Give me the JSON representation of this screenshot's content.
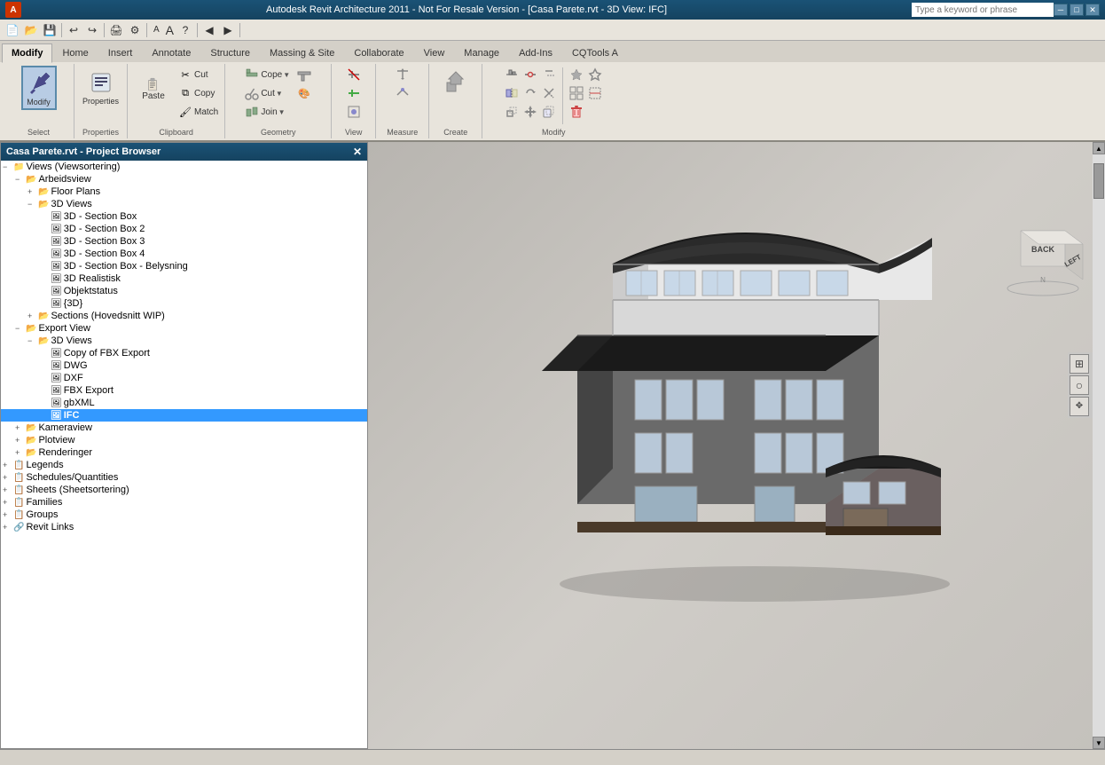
{
  "title_bar": {
    "title": "Autodesk Revit Architecture 2011 - Not For Resale Version - [Casa Parete.rvt - 3D View: IFC]",
    "search_placeholder": "Type a keyword or phrase"
  },
  "ribbon": {
    "tabs": [
      {
        "label": "Modify",
        "active": true
      },
      {
        "label": "Home",
        "active": false
      },
      {
        "label": "Insert",
        "active": false
      },
      {
        "label": "Annotate",
        "active": false
      },
      {
        "label": "Structure",
        "active": false
      },
      {
        "label": "Massing & Site",
        "active": false
      },
      {
        "label": "Collaborate",
        "active": false
      },
      {
        "label": "View",
        "active": false
      },
      {
        "label": "Manage",
        "active": false
      },
      {
        "label": "Add-Ins",
        "active": false
      },
      {
        "label": "CQTools A",
        "active": false
      }
    ],
    "groups": {
      "select": {
        "label": "Select",
        "btn_label": "Modify"
      },
      "properties": {
        "label": "Properties"
      },
      "clipboard": {
        "label": "Clipboard",
        "paste": "Paste"
      },
      "geometry": {
        "label": "Geometry",
        "cope": "Cope",
        "cut": "Cut",
        "join": "Join"
      },
      "view": {
        "label": "View"
      },
      "measure": {
        "label": "Measure"
      },
      "create": {
        "label": "Create"
      },
      "modify": {
        "label": "Modify"
      }
    }
  },
  "project_browser": {
    "title": "Casa Parete.rvt - Project Browser",
    "tree": [
      {
        "id": "views",
        "label": "Views (Viewsortering)",
        "level": 0,
        "type": "root",
        "expanded": true
      },
      {
        "id": "arbeidsview",
        "label": "Arbeidsview",
        "level": 1,
        "type": "folder",
        "expanded": true
      },
      {
        "id": "floor-plans",
        "label": "Floor Plans",
        "level": 2,
        "type": "folder",
        "expanded": false
      },
      {
        "id": "3d-views",
        "label": "3D Views",
        "level": 2,
        "type": "folder",
        "expanded": true
      },
      {
        "id": "section-box",
        "label": "3D - Section Box",
        "level": 3,
        "type": "view"
      },
      {
        "id": "section-box-2",
        "label": "3D - Section Box 2",
        "level": 3,
        "type": "view"
      },
      {
        "id": "section-box-3",
        "label": "3D - Section Box 3",
        "level": 3,
        "type": "view"
      },
      {
        "id": "section-box-4",
        "label": "3D - Section Box 4",
        "level": 3,
        "type": "view"
      },
      {
        "id": "section-box-bel",
        "label": "3D - Section Box - Belysning",
        "level": 3,
        "type": "view"
      },
      {
        "id": "3d-realistisk",
        "label": "3D Realistisk",
        "level": 3,
        "type": "view"
      },
      {
        "id": "objektstatus",
        "label": "Objektstatus",
        "level": 3,
        "type": "view"
      },
      {
        "id": "3d-curly",
        "label": "{3D}",
        "level": 3,
        "type": "view"
      },
      {
        "id": "sections-hoved",
        "label": "Sections (Hovedsnitt WIP)",
        "level": 2,
        "type": "folder",
        "expanded": false
      },
      {
        "id": "export-view",
        "label": "Export View",
        "level": 1,
        "type": "folder",
        "expanded": true
      },
      {
        "id": "3d-views-export",
        "label": "3D Views",
        "level": 2,
        "type": "folder",
        "expanded": true
      },
      {
        "id": "copy-fbx",
        "label": "Copy of FBX Export",
        "level": 3,
        "type": "view"
      },
      {
        "id": "dwf",
        "label": "DWG",
        "level": 3,
        "type": "view"
      },
      {
        "id": "dxf",
        "label": "DXF",
        "level": 3,
        "type": "view"
      },
      {
        "id": "fbx-export",
        "label": "FBX Export",
        "level": 3,
        "type": "view"
      },
      {
        "id": "gbxml",
        "label": "gbXML",
        "level": 3,
        "type": "view"
      },
      {
        "id": "ifc",
        "label": "IFC",
        "level": 3,
        "type": "view",
        "selected": true
      },
      {
        "id": "kameraview",
        "label": "Kameraview",
        "level": 1,
        "type": "folder",
        "expanded": false
      },
      {
        "id": "plotview",
        "label": "Plotview",
        "level": 1,
        "type": "folder",
        "expanded": false
      },
      {
        "id": "renderinger",
        "label": "Renderinger",
        "level": 1,
        "type": "folder",
        "expanded": false
      },
      {
        "id": "legends",
        "label": "Legends",
        "level": 0,
        "type": "section"
      },
      {
        "id": "schedules",
        "label": "Schedules/Quantities",
        "level": 0,
        "type": "section"
      },
      {
        "id": "sheets",
        "label": "Sheets (Sheetsortering)",
        "level": 0,
        "type": "section"
      },
      {
        "id": "families",
        "label": "Families",
        "level": 0,
        "type": "section"
      },
      {
        "id": "groups",
        "label": "Groups",
        "level": 0,
        "type": "section"
      },
      {
        "id": "revit-links",
        "label": "Revit Links",
        "level": 0,
        "type": "section-link"
      }
    ]
  },
  "viewport": {
    "view_cube": {
      "back": "BACK",
      "left": "LEFT"
    }
  },
  "status_bar": {
    "text": ""
  }
}
